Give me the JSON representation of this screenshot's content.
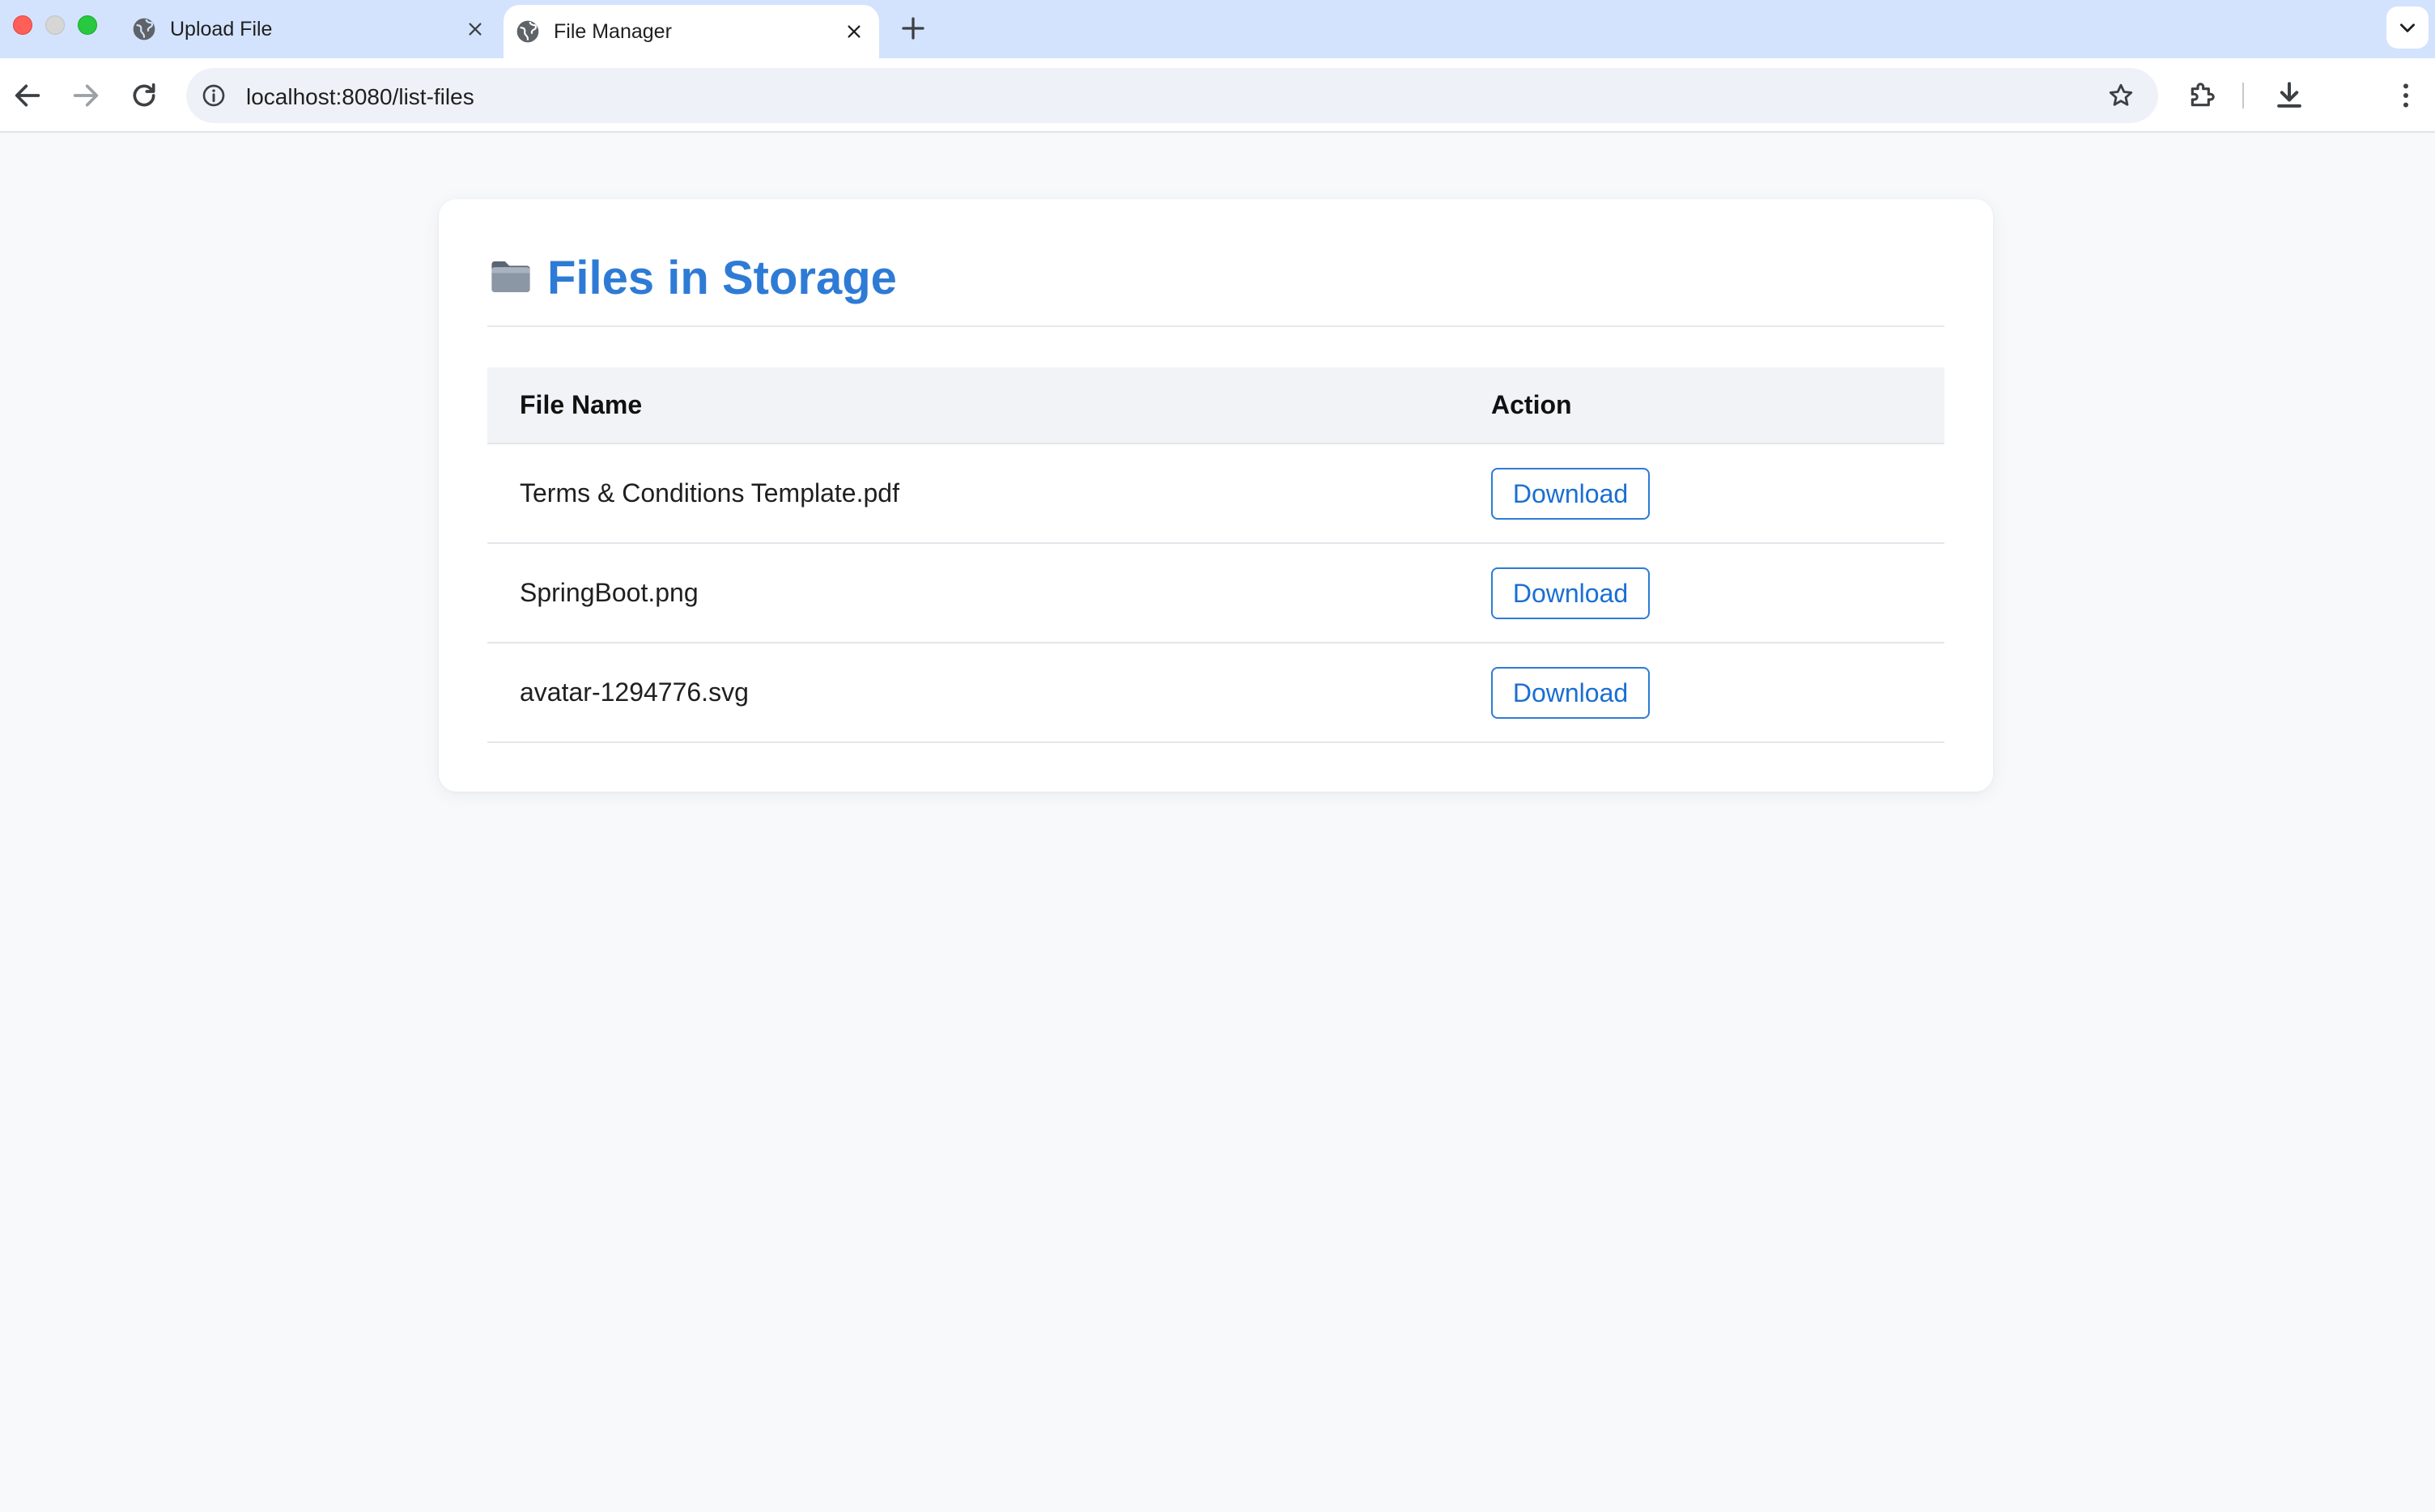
{
  "browser": {
    "tabs": [
      {
        "title": "Upload File",
        "active": false
      },
      {
        "title": "File Manager",
        "active": true
      }
    ],
    "url": "localhost:8080/list-files"
  },
  "page": {
    "title": "Files in Storage",
    "title_icon": "folder-icon",
    "accent_color": "#2e7bd6",
    "table": {
      "columns": [
        "File Name",
        "Action"
      ],
      "rows": [
        {
          "file_name": "Terms & Conditions Template.pdf",
          "action": "Download"
        },
        {
          "file_name": "SpringBoot.png",
          "action": "Download"
        },
        {
          "file_name": "avatar-1294776.svg",
          "action": "Download"
        }
      ]
    }
  }
}
